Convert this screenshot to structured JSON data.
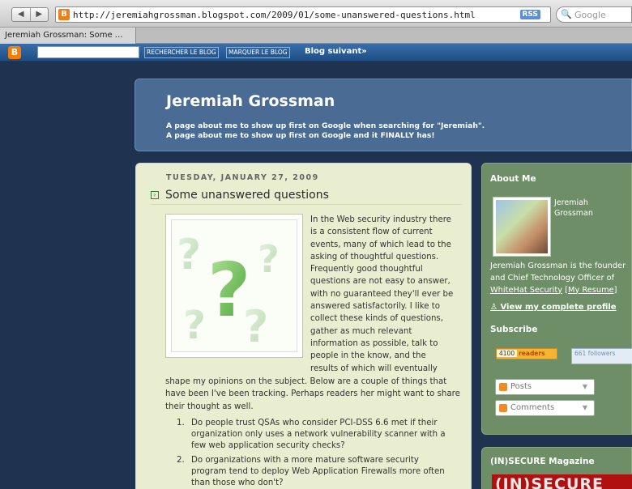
{
  "browser": {
    "url": "http://jeremiahgrossman.blogspot.com/2009/01/some-unanswered-questions.html",
    "rss_label": "RSS",
    "search_placeholder": "Google",
    "tab_title": "Jeremiah Grossman: Some ..."
  },
  "navbar": {
    "search_button": "RECHERCHER LE BLOG",
    "flag_button": "MARQUER LE BLOG",
    "next_blog": "Blog suivant»"
  },
  "header": {
    "title": "Jeremiah Grossman",
    "description_line1": "A page about me to show up first on Google when searching for \"Jeremiah\".",
    "description_line2": "A page about me to show up first on Google and it FINALLY has!"
  },
  "post": {
    "date": "TUESDAY, JANUARY 27, 2009",
    "title": "Some unanswered questions",
    "body_side": "In the Web security industry there is a consistent flow of current events, many of which lead to the asking of thoughtful questions. Frequently good thoughtful questions are not easy to answer, with no guaranteed they'll ever be answered satisfactorily. I like to collect these kinds of questions, gather as much relevant information as possible, talk to people in the know, and the results of which will eventually",
    "body_full": "shape my opinions on the subject. Below are a couple of things that have been I've been tracking. Perhaps readers her might want to share their thought as well.",
    "list": [
      {
        "num": "1.",
        "text": "Do people trust QSAs who consider PCI-DSS 6.6 met if their organization only uses a network vulnerability scanner with a few web application security checks?"
      },
      {
        "num": "2.",
        "text": "Do organizations with a more mature software security program tend to deploy Web Application Firewalls more often than those who don't?"
      }
    ]
  },
  "sidebar": {
    "about_heading": "About Me",
    "author_name": "Jeremiah Grossman",
    "bio_prefix": "Jeremiah Grossman is the founder and Chief Technology Officer of ",
    "bio_link": "WhiteHat Security",
    "bio_resume": "[My Resume]",
    "profile_link": "View my complete profile",
    "subscribe_heading": "Subscribe",
    "readers_count": "4100",
    "readers_label": "readers",
    "followers_count": "661",
    "followers_label": "followers",
    "posts_label": "Posts",
    "comments_label": "Comments",
    "magazine_heading": "(IN)SECURE Magazine",
    "magazine_banner": "(IN)SECURE"
  }
}
